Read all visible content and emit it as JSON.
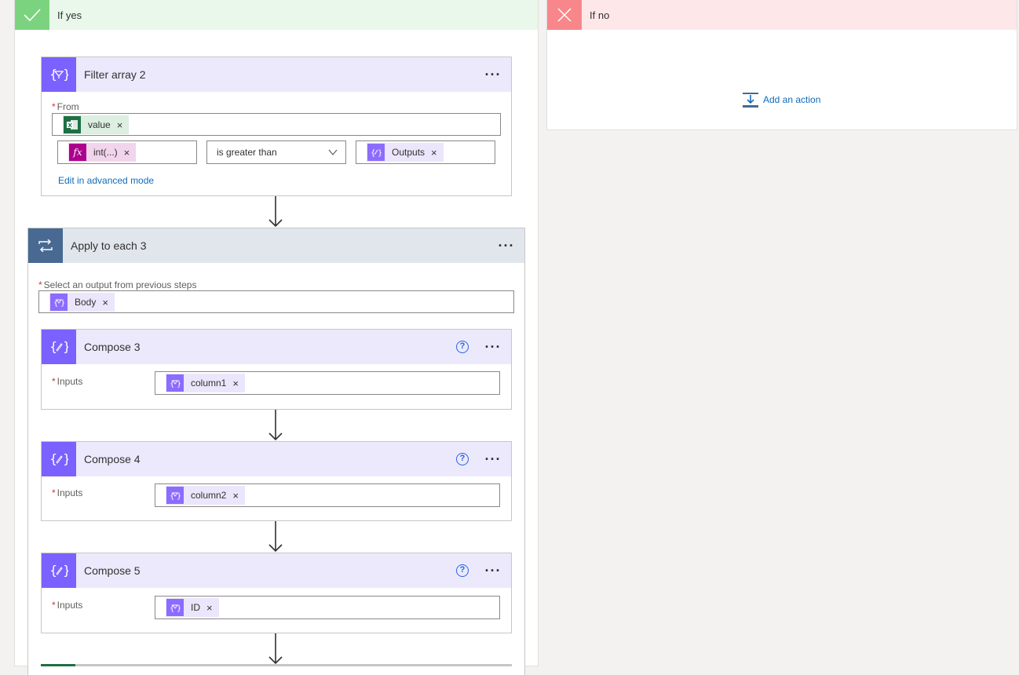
{
  "branches": {
    "yes": {
      "title": "If yes",
      "color": "#7cd37f"
    },
    "no": {
      "title": "If no",
      "color": "#f7878a",
      "add_action_label": "Add an action"
    }
  },
  "filter_array": {
    "title": "Filter array 2",
    "menu_label": "···",
    "from_label": "From",
    "from_token": "value",
    "left_token": "int(...)",
    "operator": "is greater than",
    "right_token": "Outputs",
    "advanced_link": "Edit in advanced mode",
    "fx_glyph": "fx"
  },
  "apply_each": {
    "title": "Apply to each 3",
    "menu_label": "···",
    "select_label": "Select an output from previous steps",
    "select_token": "Body"
  },
  "composes": [
    {
      "title": "Compose 3",
      "inputs_label": "Inputs",
      "token": "column1",
      "help": "?",
      "menu_label": "···"
    },
    {
      "title": "Compose 4",
      "inputs_label": "Inputs",
      "token": "column2",
      "help": "?",
      "menu_label": "···"
    },
    {
      "title": "Compose 5",
      "inputs_label": "Inputs",
      "token": "ID",
      "help": "?",
      "menu_label": "···"
    }
  ],
  "required_mark": "*",
  "remove_glyph": "×",
  "colors": {
    "action_purple": "#7b61ff",
    "loop_blue": "#486991",
    "excel_green": "#1d7044",
    "expression_pink": "#ad008c",
    "link_blue": "#0f6cbd"
  }
}
